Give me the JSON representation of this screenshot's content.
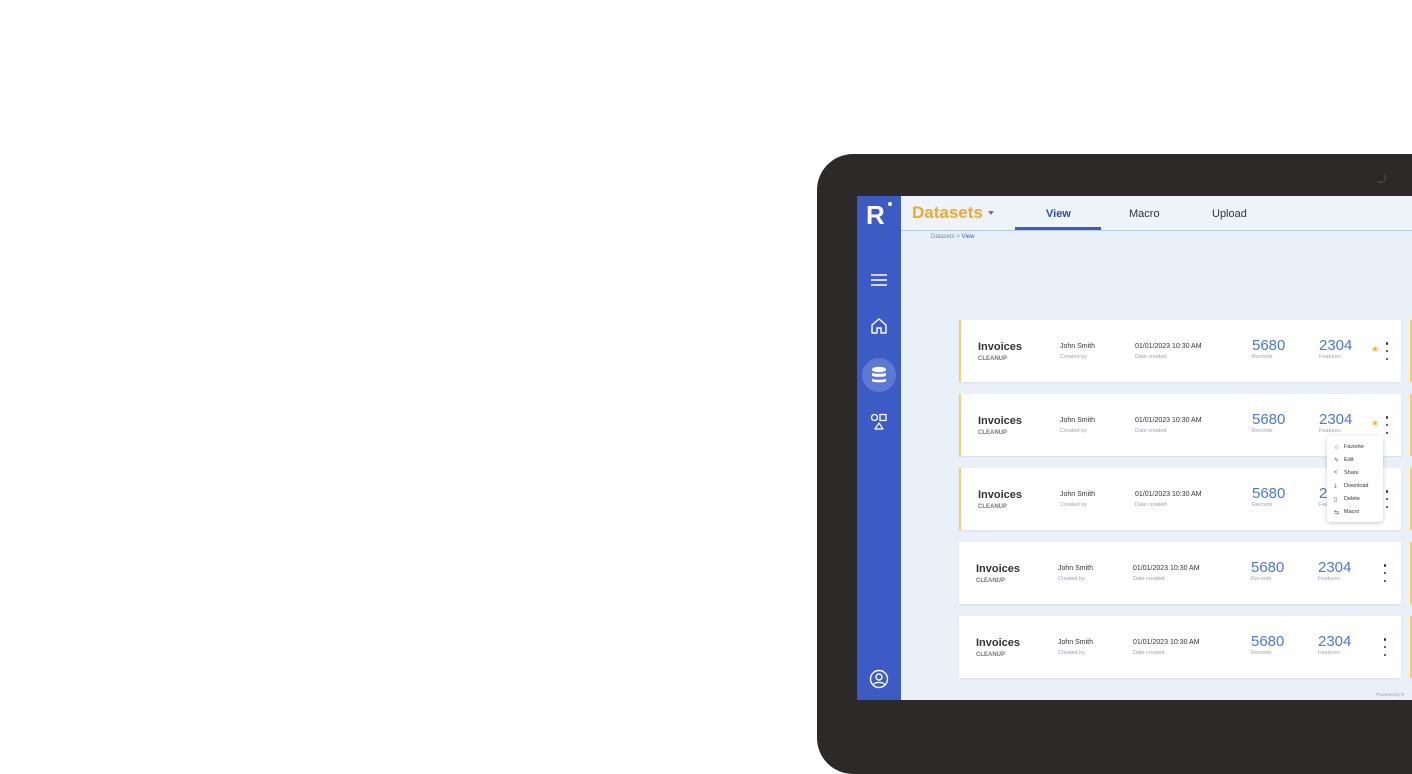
{
  "app": {
    "title": "Datasets",
    "logo": "R",
    "tabs": [
      {
        "label": "View",
        "active": true
      },
      {
        "label": "Macro",
        "active": false
      },
      {
        "label": "Upload",
        "active": false
      }
    ],
    "breadcrumb": {
      "parent": "Datasets",
      "separator": ">",
      "current": "View"
    },
    "sidebar_icons": [
      "menu-icon",
      "home-icon",
      "database-icon",
      "shapes-icon",
      "user-icon"
    ],
    "accent": "#3d5bc4",
    "title_color": "#f0a92a"
  },
  "datasets": [
    {
      "name": "Invoices",
      "tag": "CLEANUP",
      "creator": "John Smith",
      "creator_label": "Created by",
      "date": "01/01/2023  10:30 AM",
      "date_label": "Date created",
      "records": "5680",
      "records_label": "Records",
      "features": "2304",
      "features_label": "Features",
      "favorite": true
    },
    {
      "name": "Invoices",
      "tag": "CLEANUP",
      "creator": "John Smith",
      "creator_label": "Created by",
      "date": "01/01/2023  10:30 AM",
      "date_label": "Date created",
      "records": "5680",
      "records_label": "Records",
      "features": "2304",
      "features_label": "Features",
      "favorite": true
    },
    {
      "name": "Invoices",
      "tag": "CLEANUP",
      "creator": "John Smith",
      "creator_label": "Created by",
      "date": "01/01/2023  10:30 AM",
      "date_label": "Date created",
      "records": "5680",
      "records_label": "Records",
      "features": "2304",
      "features_label": "Features",
      "favorite": false
    },
    {
      "name": "Invoices",
      "tag": "CLEANUP",
      "creator": "John Smith",
      "creator_label": "Created by",
      "date": "01/01/2023  10:30 AM",
      "date_label": "Date created",
      "records": "5680",
      "records_label": "Records",
      "features": "2304",
      "features_label": "Features",
      "favorite": false
    },
    {
      "name": "Invoices",
      "tag": "CLEANUP",
      "creator": "John Smith",
      "creator_label": "Created by",
      "date": "01/01/2023  10:30 AM",
      "date_label": "Date created",
      "records": "5680",
      "records_label": "Records",
      "features": "2304",
      "features_label": "Features",
      "favorite": false
    }
  ],
  "context_menu": [
    {
      "label": "Favorite",
      "icon": "star-icon"
    },
    {
      "label": "Edit",
      "icon": "pencil-icon"
    },
    {
      "label": "Share",
      "icon": "share-icon"
    },
    {
      "label": "Download",
      "icon": "download-icon"
    },
    {
      "label": "Delete",
      "icon": "trash-icon"
    },
    {
      "label": "Macro",
      "icon": "macro-icon"
    }
  ],
  "footer": {
    "powered_by": "Powered by R"
  }
}
